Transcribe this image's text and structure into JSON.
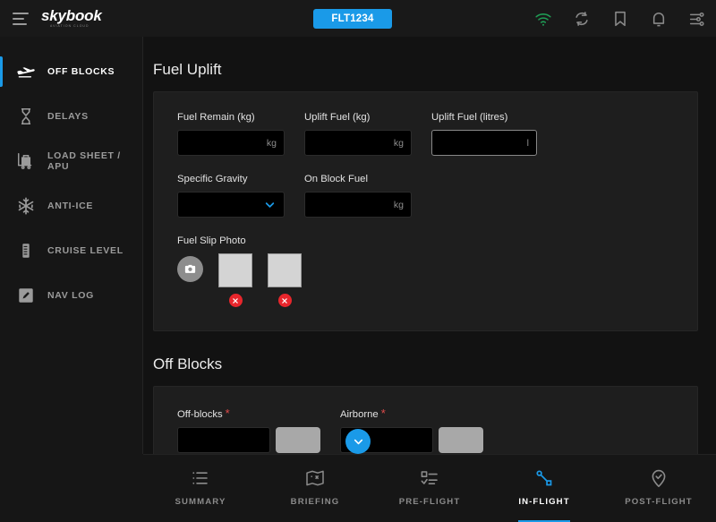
{
  "header": {
    "menu_icon": "hamburger-icon",
    "logo_text": "skybook",
    "logo_subtext": "aviation cloud",
    "flight_badge": "FLT1234",
    "icons": [
      {
        "name": "wifi-icon",
        "color": "#1f9d55"
      },
      {
        "name": "sync-icon",
        "color": "#8a8a8a"
      },
      {
        "name": "bookmark-icon",
        "color": "#8a8a8a"
      },
      {
        "name": "bell-icon",
        "color": "#8a8a8a"
      },
      {
        "name": "settings-sliders-icon",
        "color": "#8a8a8a"
      }
    ]
  },
  "sidebar": {
    "items": [
      {
        "label": "OFF BLOCKS",
        "icon": "plane-departure-icon",
        "active": true
      },
      {
        "label": "DELAYS",
        "icon": "hourglass-icon",
        "active": false
      },
      {
        "label": "LOAD SHEET / APU",
        "icon": "luggage-cart-icon",
        "active": false
      },
      {
        "label": "ANTI-ICE",
        "icon": "snowflake-icon",
        "active": false
      },
      {
        "label": "CRUISE LEVEL",
        "icon": "ruler-icon",
        "active": false
      },
      {
        "label": "NAV LOG",
        "icon": "pencil-square-icon",
        "active": false
      }
    ]
  },
  "main": {
    "fuel_uplift": {
      "heading": "Fuel Uplift",
      "row1": [
        {
          "label": "Fuel Remain (kg)",
          "value": "",
          "suffix": "kg",
          "focused": false
        },
        {
          "label": "Uplift Fuel (kg)",
          "value": "",
          "suffix": "kg",
          "focused": false
        },
        {
          "label": "Uplift Fuel (litres)",
          "value": "",
          "suffix": "l",
          "focused": true
        }
      ],
      "row2": [
        {
          "label": "Specific Gravity",
          "value": "",
          "type": "select",
          "chevron_icon": "chevron-down-icon"
        },
        {
          "label": "On Block Fuel",
          "value": "",
          "suffix": "kg",
          "type": "text"
        }
      ],
      "photo": {
        "label": "Fuel Slip Photo",
        "camera_icon": "camera-icon",
        "thumbnails": [
          {
            "name": "fuel-slip-thumb-1",
            "delete_icon": "close-x-icon"
          },
          {
            "name": "fuel-slip-thumb-2",
            "delete_icon": "close-x-icon"
          }
        ]
      }
    },
    "off_blocks": {
      "heading": "Off Blocks",
      "fields": [
        {
          "label": "Off-blocks",
          "required": "*",
          "value": "",
          "button_label": ""
        },
        {
          "label": "Airborne",
          "required": "*",
          "value": "",
          "button_label": ""
        }
      ]
    },
    "scroll_fab": {
      "icon": "chevron-down-icon",
      "color": "#1a9ae8"
    }
  },
  "bottom_nav": {
    "items": [
      {
        "label": "SUMMARY",
        "icon": "list-icon",
        "active": false
      },
      {
        "label": "BRIEFING",
        "icon": "map-icon",
        "active": false
      },
      {
        "label": "PRE-FLIGHT",
        "icon": "checklist-icon",
        "active": false
      },
      {
        "label": "IN-FLIGHT",
        "icon": "route-icon",
        "active": true
      },
      {
        "label": "POST-FLIGHT",
        "icon": "pin-check-icon",
        "active": false
      }
    ]
  },
  "colors": {
    "accent": "#1a9ae8",
    "page_bg": "#121212",
    "card_bg": "#1e1e1e",
    "header_bg": "#191919",
    "danger": "#e8262c",
    "wifi_green": "#1f9d55",
    "required_red": "#e04b4b"
  }
}
